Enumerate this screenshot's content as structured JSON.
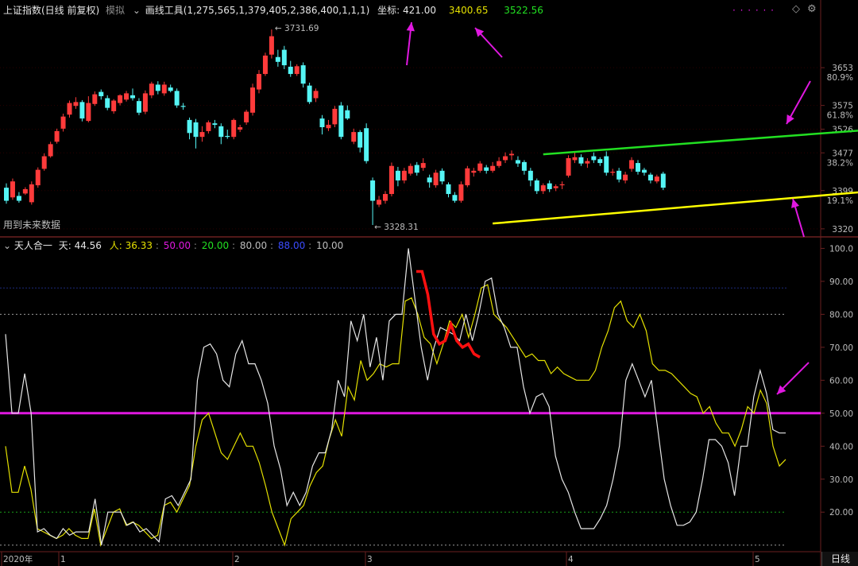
{
  "colors": {
    "up": "#ff3b3b",
    "down": "#55f5f5",
    "white_line": "#e6e6e6",
    "yellow_line": "#e4e000",
    "magenta": "#e018e0",
    "green_line": "#22e022",
    "channel_low": "#ffff00",
    "grid_navy": "#1c2a7a",
    "grid_dotted": "#9a9a9a",
    "grid_green": "#18a018"
  },
  "header": {
    "index_name": "上证指数(日线 前复权)",
    "mode": "模拟",
    "tool_label": "画线工具(1,275,565,1,379,405,2,386,400,1,1,1)",
    "coord_label": "坐标: 421.00",
    "value_yellow": "3400.65",
    "value_green": "3522.56",
    "dots": "·  ·  ·  ·  ·  ·",
    "icon_diamond": "◇",
    "icon_gear": "⚙"
  },
  "price_panel": {
    "future_data_label": "用到未来数据",
    "high_annotation": "3731.69",
    "low_annotation": "3328.31",
    "axis_ticks": [
      {
        "value": "3653",
        "sub": "80.9%",
        "price": 3653
      },
      {
        "value": "3575",
        "sub": "61.8%",
        "price": 3575
      },
      {
        "value": "3526",
        "sub": "",
        "price": 3526
      },
      {
        "value": "3477",
        "sub": "38.2%",
        "price": 3477
      },
      {
        "value": "3399",
        "sub": "19.1%",
        "price": 3399
      },
      {
        "value": "3320",
        "sub": "",
        "price": 3320
      }
    ]
  },
  "indicator_panel": {
    "name": "天人合一",
    "tian_label": "天: 44.56",
    "ren_label": "人: 36.33",
    "level_50": "50.00",
    "level_20": "20.00",
    "level_80": "80.00",
    "level_88": "88.00",
    "level_10": "10.00",
    "axis_ticks": [
      "100.0",
      "90.00",
      "80.00",
      "70.00",
      "60.00",
      "50.00",
      "40.00",
      "30.00",
      "20.00"
    ]
  },
  "time_axis": {
    "labels": [
      "2020年",
      "1",
      "2",
      "3",
      "4",
      "5"
    ],
    "period_button": "日线"
  },
  "chart_data": {
    "type": "candlestick",
    "price_range": [
      3305,
      3760
    ],
    "candles": [
      [
        3405,
        3378,
        3414,
        3372
      ],
      [
        3385,
        3418,
        3424,
        3380
      ],
      [
        3388,
        3378,
        3396,
        3374
      ],
      [
        3393,
        3402,
        3406,
        3390
      ],
      [
        3375,
        3412,
        3418,
        3370
      ],
      [
        3410,
        3442,
        3447,
        3405
      ],
      [
        3444,
        3470,
        3476,
        3440
      ],
      [
        3470,
        3495,
        3500,
        3467
      ],
      [
        3500,
        3522,
        3527,
        3496
      ],
      [
        3527,
        3552,
        3558,
        3521
      ],
      [
        3556,
        3580,
        3585,
        3550
      ],
      [
        3574,
        3582,
        3592,
        3568
      ],
      [
        3582,
        3548,
        3586,
        3542
      ],
      [
        3543,
        3580,
        3594,
        3540
      ],
      [
        3578,
        3598,
        3604,
        3574
      ],
      [
        3603,
        3594,
        3608,
        3587
      ],
      [
        3590,
        3570,
        3596,
        3565
      ],
      [
        3563,
        3585,
        3588,
        3558
      ],
      [
        3580,
        3596,
        3598,
        3575
      ],
      [
        3587,
        3600,
        3605,
        3583
      ],
      [
        3596,
        3590,
        3610,
        3585
      ],
      [
        3584,
        3560,
        3590,
        3555
      ],
      [
        3562,
        3600,
        3606,
        3557
      ],
      [
        3596,
        3620,
        3624,
        3590
      ],
      [
        3618,
        3605,
        3625,
        3598
      ],
      [
        3600,
        3618,
        3624,
        3595
      ],
      [
        3612,
        3605,
        3618,
        3602
      ],
      [
        3605,
        3575,
        3610,
        3570
      ],
      [
        3574,
        3572,
        3580,
        3566
      ],
      [
        3545,
        3518,
        3550,
        3505
      ],
      [
        3540,
        3510,
        3547,
        3486
      ],
      [
        3510,
        3520,
        3532,
        3500
      ],
      [
        3522,
        3540,
        3544,
        3517
      ],
      [
        3538,
        3535,
        3545,
        3528
      ],
      [
        3532,
        3510,
        3538,
        3495
      ],
      [
        3512,
        3510,
        3525,
        3506
      ],
      [
        3510,
        3545,
        3548,
        3505
      ],
      [
        3525,
        3530,
        3535,
        3520
      ],
      [
        3540,
        3562,
        3566,
        3535
      ],
      [
        3560,
        3612,
        3620,
        3554
      ],
      [
        3608,
        3640,
        3648,
        3600
      ],
      [
        3640,
        3678,
        3684,
        3636
      ],
      [
        3680,
        3718,
        3732,
        3672
      ],
      [
        3675,
        3665,
        3690,
        3655
      ],
      [
        3690,
        3658,
        3698,
        3650
      ],
      [
        3655,
        3640,
        3667,
        3634
      ],
      [
        3640,
        3656,
        3660,
        3636
      ],
      [
        3658,
        3620,
        3664,
        3612
      ],
      [
        3616,
        3582,
        3622,
        3578
      ],
      [
        3590,
        3605,
        3610,
        3582
      ],
      [
        3548,
        3530,
        3555,
        3515
      ],
      [
        3528,
        3535,
        3545,
        3522
      ],
      [
        3536,
        3568,
        3574,
        3530
      ],
      [
        3575,
        3510,
        3582,
        3505
      ],
      [
        3565,
        3548,
        3575,
        3545
      ],
      [
        3500,
        3520,
        3527,
        3495
      ],
      [
        3520,
        3488,
        3524,
        3478
      ],
      [
        3528,
        3460,
        3538,
        3455
      ],
      [
        3420,
        3378,
        3426,
        3328
      ],
      [
        3370,
        3380,
        3388,
        3365
      ],
      [
        3378,
        3392,
        3398,
        3372
      ],
      [
        3392,
        3450,
        3457,
        3387
      ],
      [
        3440,
        3420,
        3448,
        3408
      ],
      [
        3420,
        3440,
        3446,
        3414
      ],
      [
        3434,
        3450,
        3455,
        3430
      ],
      [
        3452,
        3436,
        3458,
        3430
      ],
      [
        3446,
        3456,
        3466,
        3440
      ],
      [
        3426,
        3416,
        3432,
        3405
      ],
      [
        3410,
        3436,
        3442,
        3405
      ],
      [
        3440,
        3418,
        3445,
        3412
      ],
      [
        3412,
        3392,
        3416,
        3385
      ],
      [
        3390,
        3378,
        3396,
        3374
      ],
      [
        3378,
        3412,
        3418,
        3374
      ],
      [
        3410,
        3445,
        3450,
        3406
      ],
      [
        3436,
        3440,
        3446,
        3428
      ],
      [
        3440,
        3455,
        3460,
        3436
      ],
      [
        3447,
        3440,
        3452,
        3434
      ],
      [
        3440,
        3450,
        3458,
        3436
      ],
      [
        3450,
        3460,
        3468,
        3446
      ],
      [
        3462,
        3470,
        3478,
        3456
      ],
      [
        3472,
        3475,
        3482,
        3462
      ],
      [
        3462,
        3455,
        3470,
        3448
      ],
      [
        3458,
        3440,
        3462,
        3432
      ],
      [
        3440,
        3420,
        3446,
        3408
      ],
      [
        3420,
        3398,
        3424,
        3392
      ],
      [
        3398,
        3410,
        3414,
        3392
      ],
      [
        3414,
        3402,
        3420,
        3396
      ],
      [
        3404,
        3408,
        3412,
        3398
      ],
      [
        3410,
        3412,
        3418,
        3402
      ],
      [
        3430,
        3466,
        3472,
        3426
      ],
      [
        3462,
        3468,
        3478,
        3456
      ],
      [
        3468,
        3455,
        3474,
        3450
      ],
      [
        3455,
        3460,
        3466,
        3446
      ],
      [
        3470,
        3462,
        3478,
        3456
      ],
      [
        3464,
        3456,
        3468,
        3450
      ],
      [
        3470,
        3436,
        3480,
        3430
      ],
      [
        3436,
        3438,
        3444,
        3430
      ],
      [
        3440,
        3422,
        3446,
        3416
      ],
      [
        3420,
        3432,
        3438,
        3414
      ],
      [
        3444,
        3462,
        3468,
        3438
      ],
      [
        3456,
        3438,
        3462,
        3432
      ],
      [
        3442,
        3436,
        3446,
        3430
      ],
      [
        3432,
        3420,
        3436,
        3414
      ],
      [
        3418,
        3428,
        3432,
        3414
      ],
      [
        3434,
        3405,
        3438,
        3400
      ]
    ],
    "green_line": {
      "x": [
        85,
        139
      ],
      "y": [
        3474,
        3527
      ]
    },
    "yellow_line": {
      "x": [
        77,
        139
      ],
      "y": [
        3331,
        3400
      ]
    },
    "indicator_range": [
      8,
      103
    ],
    "white_line": [
      74,
      50,
      50,
      62,
      50,
      14,
      15,
      13,
      12,
      15,
      13,
      14,
      14,
      14,
      24,
      10,
      20,
      20,
      20,
      16,
      17,
      14,
      15,
      13,
      11,
      24,
      25,
      22,
      26,
      30,
      60,
      70,
      71,
      68,
      60,
      58,
      68,
      72,
      65,
      65,
      60,
      53,
      40,
      33,
      22,
      26,
      22,
      26,
      34,
      38,
      38,
      45,
      60,
      55,
      78,
      72,
      80,
      64,
      73,
      60,
      78,
      80,
      80,
      100,
      85,
      70,
      60,
      70,
      76,
      75,
      74,
      72,
      80,
      72,
      80,
      90,
      91,
      80,
      76,
      70,
      70,
      58,
      50,
      55,
      56,
      52,
      37,
      30,
      26,
      20,
      15,
      15,
      15,
      18,
      22,
      30,
      40,
      60,
      65,
      60,
      55,
      60,
      45,
      30,
      22,
      16,
      16,
      17,
      20,
      30,
      42,
      42,
      40,
      35,
      25,
      40,
      40,
      55,
      63,
      56,
      45,
      44,
      44
    ],
    "yellow_line_ind": [
      40,
      26,
      26,
      34,
      27,
      15,
      14,
      13,
      12,
      13,
      15,
      13,
      12,
      12,
      21,
      10,
      15,
      20,
      21,
      16,
      17,
      16,
      14,
      12,
      13,
      22,
      23,
      20,
      24,
      28,
      40,
      48,
      50,
      44,
      38,
      36,
      40,
      44,
      40,
      40,
      35,
      28,
      20,
      15,
      10,
      18,
      20,
      22,
      28,
      32,
      34,
      42,
      48,
      43,
      58,
      54,
      66,
      60,
      62,
      65,
      64,
      65,
      65,
      84,
      85,
      80,
      73,
      71,
      65,
      71,
      78,
      76,
      80,
      73,
      80,
      88,
      89,
      80,
      78,
      76,
      73,
      70,
      67,
      68,
      66,
      66,
      62,
      64,
      62,
      61,
      60,
      60,
      60,
      63,
      70,
      75,
      82,
      84,
      78,
      76,
      80,
      75,
      65,
      63,
      63,
      62,
      60,
      58,
      56,
      55,
      50,
      52,
      47,
      44,
      44,
      40,
      45,
      52,
      50,
      57,
      53,
      40,
      34,
      36
    ],
    "red_segment": [
      93,
      93,
      86,
      74,
      71,
      72,
      77,
      72,
      70,
      71,
      68,
      67
    ]
  }
}
